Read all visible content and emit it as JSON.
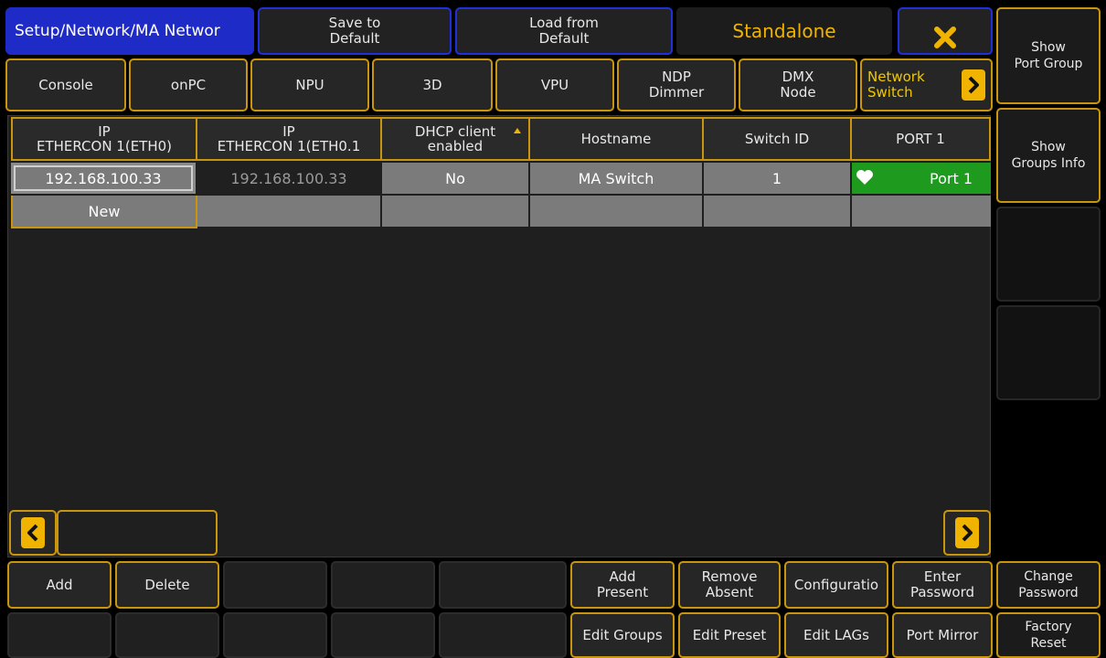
{
  "header": {
    "title": "Setup/Network/MA Networ",
    "save_label": "Save to\nDefault",
    "load_label": "Load from\nDefault",
    "mode_label": "Standalone"
  },
  "tabs": {
    "console": "Console",
    "onpc": "onPC",
    "npu": "NPU",
    "three_d": "3D",
    "vpu": "VPU",
    "ndp": "NDP\nDimmer",
    "dmx": "DMX\nNode",
    "network": "Network\nSwitch"
  },
  "sidebar": {
    "show_port_group": "Show\nPort Group",
    "show_groups_info": "Show\nGroups Info",
    "change_password": "Change\nPassword",
    "factory_reset": "Factory\nReset"
  },
  "table": {
    "headers": {
      "ip1": "IP\nETHERCON 1(ETH0)",
      "ip2": "IP\nETHERCON 1(ETH0.1",
      "dhcp": "DHCP client\nenabled",
      "hostname": "Hostname",
      "switch_id": "Switch ID",
      "port1": "PORT 1"
    },
    "row": {
      "ip1": "192.168.100.33",
      "ip2": "192.168.100.33",
      "dhcp": "No",
      "hostname": "MA Switch",
      "switch_id": "1",
      "port1": "Port 1"
    },
    "new_label": "New"
  },
  "bottom": {
    "add": "Add",
    "delete": "Delete",
    "add_present": "Add\nPresent",
    "remove_absent": "Remove\nAbsent",
    "configuration": "Configuratio",
    "enter_password": "Enter\nPassword",
    "edit_groups": "Edit Groups",
    "edit_preset": "Edit Preset",
    "edit_lags": "Edit LAGs",
    "port_mirror": "Port Mirror"
  },
  "colors": {
    "accent": "#c9950e",
    "title_blue": "#1f2bc6",
    "port_green": "#1e9a1e"
  }
}
